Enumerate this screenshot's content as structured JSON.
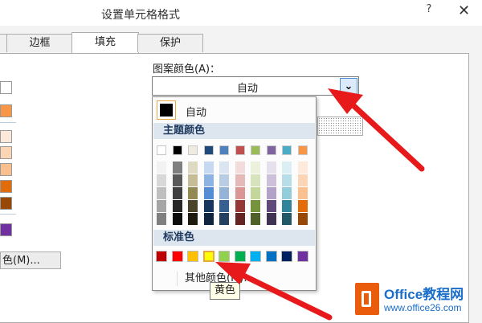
{
  "window": {
    "title": "设置单元格格式",
    "help_label": "?",
    "close_label": "✕"
  },
  "tabs": [
    {
      "label": "边框",
      "active": false
    },
    {
      "label": "填充",
      "active": true
    },
    {
      "label": "保护",
      "active": false
    }
  ],
  "left_panel": {
    "swatches": [
      "#ffffff",
      "#f79646",
      "#fde9d9",
      "#fcd5b4",
      "#fabf8f",
      "#e26b0a",
      "#974706",
      "#7030a0"
    ],
    "more_colors_label": "色(M)..."
  },
  "pattern_color": {
    "label": "图案颜色(A)：",
    "value": "自动",
    "dropdown_icon": "chevron-down-icon"
  },
  "color_picker": {
    "auto_label": "自动",
    "auto_color": "#000000",
    "theme_header": "主题颜色",
    "theme_base": [
      "#ffffff",
      "#000000",
      "#eeece1",
      "#1f497d",
      "#4f81bd",
      "#c0504d",
      "#9bbb59",
      "#8064a2",
      "#4bacc6",
      "#f79646"
    ],
    "theme_shades": [
      [
        "#f2f2f2",
        "#7f7f7f",
        "#ddd9c3",
        "#c6d9f0",
        "#dbe5f1",
        "#f2dcdb",
        "#ebf1dd",
        "#e5e0ec",
        "#dbeef3",
        "#fdeada"
      ],
      [
        "#d8d8d8",
        "#595959",
        "#c4bd97",
        "#8db3e2",
        "#b8cce4",
        "#e5b9b7",
        "#d7e3bc",
        "#ccc1d9",
        "#b7dde8",
        "#fbd5b5"
      ],
      [
        "#bfbfbf",
        "#3f3f3f",
        "#938953",
        "#548dd4",
        "#95b3d7",
        "#d99694",
        "#c3d69b",
        "#b2a2c7",
        "#92cddc",
        "#fac08f"
      ],
      [
        "#a5a5a5",
        "#262626",
        "#494429",
        "#17365d",
        "#366092",
        "#953734",
        "#76923c",
        "#5f497a",
        "#31859b",
        "#e36c09"
      ],
      [
        "#7f7f7f",
        "#0c0c0c",
        "#1d1b10",
        "#0f243e",
        "#244061",
        "#632423",
        "#4f6128",
        "#3f3151",
        "#205867",
        "#974806"
      ]
    ],
    "standard_header": "标准色",
    "standard_colors": [
      "#c00000",
      "#ff0000",
      "#ffc000",
      "#ffff00",
      "#92d050",
      "#00b050",
      "#00b0f0",
      "#0070c0",
      "#002060",
      "#7030a0"
    ],
    "selected_standard_index": 3,
    "other_colors_label": "其他颜色(M)..."
  },
  "tooltip": {
    "text": "黄色"
  },
  "watermark": {
    "name": "Office教程网",
    "url": "www.office26.com"
  },
  "annotation_color": "#e8191b"
}
